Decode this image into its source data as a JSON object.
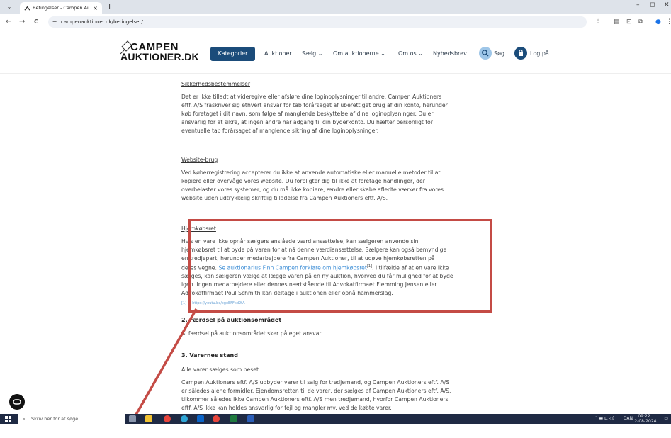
{
  "browser": {
    "tab_title": "Betingelser - Campen Auktioner",
    "tab_close": "×",
    "new_tab": "+",
    "url": "campenauktioner.dk/betingelser/",
    "back": "←",
    "forward": "→",
    "reload": "C",
    "win_min": "–",
    "win_max": "◻",
    "win_close": "✕"
  },
  "header": {
    "logo_line1": "CAMPEN",
    "logo_line2": "AUKTIONER.DK",
    "kategorier": "Kategorier",
    "auktioner": "Auktioner",
    "saelg": "Sælg ⌄",
    "om_auktionerne": "Om auktionerne ⌄",
    "om_os": "Om os ⌄",
    "nyhedsbrev": "Nyhedsbrev",
    "sog": "Søg",
    "log_paa": "Log på"
  },
  "content": {
    "sikkerhed_heading": "Sikkerhedsbestemmelser",
    "sikkerhed_lines": [
      "Det er ikke tilladt at videregive eller afsløre dine loginoplysninger til andre. Campen Auktioners",
      "eftf. A/S fraskriver sig ethvert ansvar for tab forårsaget af uberettiget brug af din konto, herunder",
      "køb foretaget i dit navn, som følge af manglende beskyttelse af dine loginoplysninger. Du er",
      "ansvarlig for at sikre, at ingen andre har adgang til din byderkonto. Du hæfter personligt for",
      "eventuelle tab forårsaget af manglende sikring af dine loginoplysninger."
    ],
    "website_heading": "Website-brug",
    "website_lines": [
      "Ved køberregistrering accepterer du ikke at anvende automatiske eller manuelle metoder til at",
      "kopiere eller overvåge vores website. Du forpligter dig til ikke at foretage handlinger, der",
      "overbelaster vores systemer, og du må ikke kopiere, ændre eller skabe afledte værker fra vores",
      "website uden udtrykkelig skriftlig tilladelse fra Campen Auktioners eftf. A/S."
    ],
    "hjem_heading": "Hjemkøbsret",
    "hjem_line1": "Hvis en vare ikke opnår sælgers anslåede værdiansættelse, kan sælgeren anvende sin",
    "hjem_line2": "hjemkøbsret til at byde på varen for at nå denne værdiansættelse. Sælgere kan også bemyndige",
    "hjem_line3": "en tredjepart, herunder medarbejdere fra Campen Auktioner, til at udøve hjemkøbsretten på",
    "hjem_line4_pre": "deres vegne. ",
    "hjem_line4_link": "Se auktionarius Finn Campen forklare om hjemkøbsret",
    "hjem_line4_sup": "[1]",
    "hjem_line4_post": ". I tilfælde af at en vare ikke",
    "hjem_line5": "sælges, kan sælgeren vælge at lægge varen på en ny auktion, hvorved du får mulighed for at byde",
    "hjem_line6": "igen. Ingen medarbejdere eller dennes nærtstående til Advokatfirmaet Flemming Jensen eller",
    "hjem_line7": "Advokatfirmaet Poul Schmith kan deltage i auktionen eller opnå hammerslag.",
    "footnote": "[1] — https://youtu.be/cgoEFFkd2tA",
    "faerdsel_heading": "2. Færdsel på auktionsområdet",
    "faerdsel_text": "Al færdsel på auktionsområdet sker på eget ansvar.",
    "stand_heading": "3. Varernes stand",
    "stand_text": "Alle varer sælges som beset.",
    "stand_lines": [
      "Campen Auktioners eftf. A/S udbyder varer til salg for tredjemand, og Campen Auktioners eftf. A/S",
      "er således alene formidler. Ejendomsretten til de varer, der sælges af Campen Auktioners eftf. A/S,",
      "tilkommer således ikke Campen Auktioners eftf. A/S men tredjemand, hvorfor Campen Auktioners",
      "eftf. A/S ikke kan holdes ansvarlig for fejl og mangler mv. ved de købte varer."
    ]
  },
  "taskbar": {
    "search_placeholder": "Skriv her for at søge",
    "lang": "DAN",
    "time": "09:22",
    "date": "12-08-2024"
  },
  "colors": {
    "accent": "#1b4c7a",
    "annotation_red": "#c44b45",
    "link": "#3d8ed6"
  }
}
